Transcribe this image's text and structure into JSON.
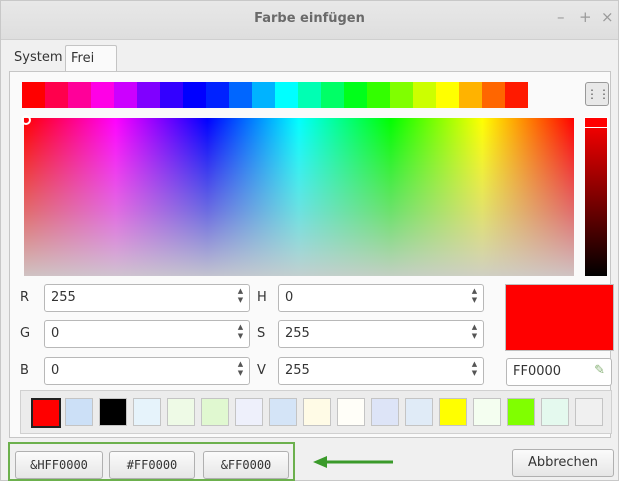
{
  "window": {
    "title": "Farbe einfügen",
    "controls": [
      "–",
      "+",
      "×"
    ]
  },
  "tabs": [
    {
      "label": "System"
    },
    {
      "label": "Frei"
    }
  ],
  "hue_strip": [
    "#ff0000",
    "#ff004c",
    "#ff0099",
    "#ff00e6",
    "#cc00ff",
    "#8000ff",
    "#3300ff",
    "#0000ff",
    "#0022ff",
    "#0066ff",
    "#00b3ff",
    "#00ffff",
    "#00ffb3",
    "#00ff66",
    "#00ff1a",
    "#33ff00",
    "#80ff00",
    "#ccff00",
    "#ffff00",
    "#ffb300",
    "#ff6600",
    "#ff1a00"
  ],
  "fields": {
    "r": {
      "label": "R",
      "value": "255"
    },
    "g": {
      "label": "G",
      "value": "0"
    },
    "b": {
      "label": "B",
      "value": "0"
    },
    "h": {
      "label": "H",
      "value": "0"
    },
    "s": {
      "label": "S",
      "value": "255"
    },
    "v": {
      "label": "V",
      "value": "255"
    }
  },
  "preview_color": "#ff0000",
  "hex_value": "FF0000",
  "palette": [
    "#ff0000",
    "#cce0f7",
    "#000000",
    "#e6f3fb",
    "#eefae6",
    "#e0f8d0",
    "#eef0fb",
    "#d4e4f7",
    "#fffbe6",
    "#fffef8",
    "#dde4f7",
    "#e0ebf7",
    "#ffff00",
    "#f4fef0",
    "#80ff00",
    "#e4f9ee",
    "#f0f0f0"
  ],
  "buttons": {
    "vb": "&HFF0000",
    "html": "#FF0000",
    "hex": "&FF0000",
    "cancel": "Abbrechen"
  },
  "accent": "#6cb04d"
}
